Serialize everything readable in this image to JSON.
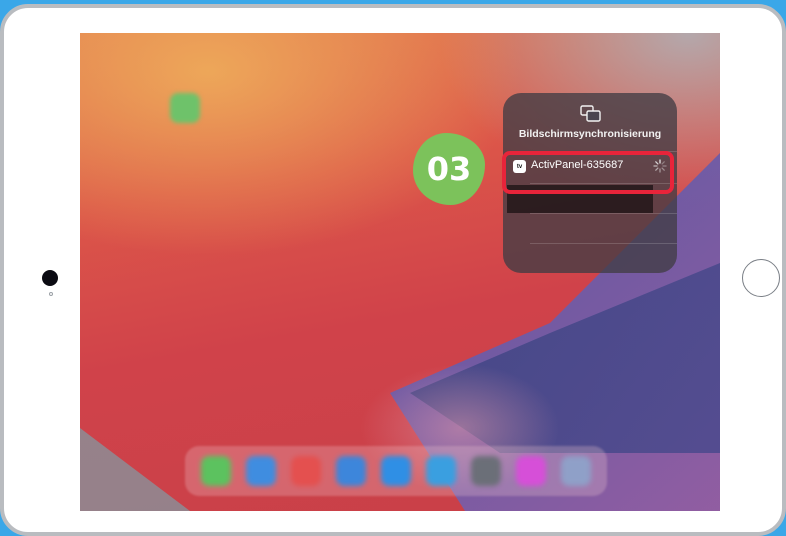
{
  "screen_mirroring": {
    "title": "Bildschirmsynchronisierung",
    "device": {
      "name": "ActivPanel-635687",
      "badge_text": "tv",
      "status_icon": "loading-spinner-icon"
    }
  },
  "tutorial": {
    "step_label": "03",
    "highlight_color": "#e8243a",
    "step_badge_color": "#7cc25b"
  },
  "colors": {
    "background": "#3aa7e8",
    "bezel": "#ffffff"
  },
  "icons": {
    "panel_icon": "screen-mirroring-icon",
    "home_button": "home-button-icon"
  }
}
